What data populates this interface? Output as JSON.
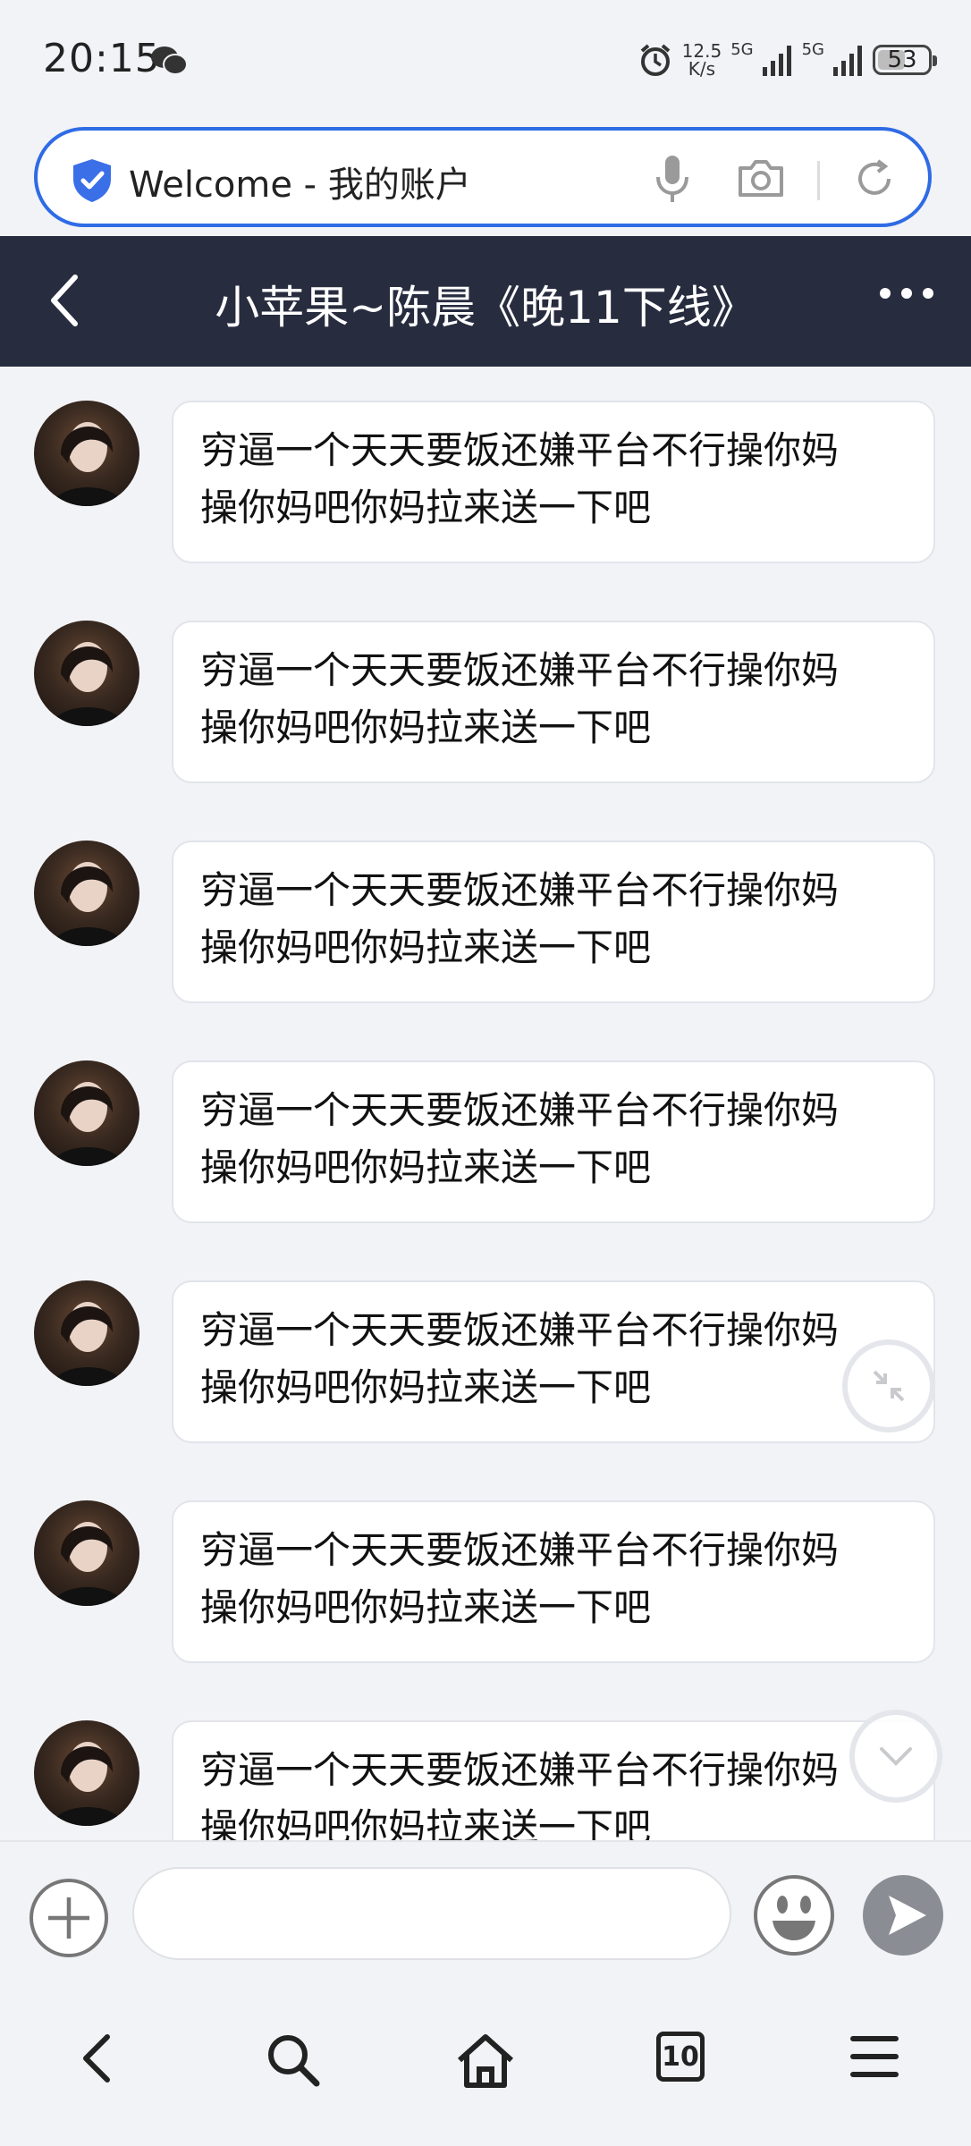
{
  "status_bar": {
    "time": "20:15",
    "net_speed_value": "12.5",
    "net_speed_unit": "K/s",
    "sim1_label": "5G",
    "sim2_label": "5G",
    "battery": "53"
  },
  "address_bar": {
    "text": "Welcome - 我的账户"
  },
  "chat": {
    "title": "小苹果~陈晨《晚11下线》",
    "messages": [
      {
        "line1": "穷逼一个天天要饭还嫌平台不行操你妈",
        "line2": "操你妈吧你妈拉来送一下吧"
      },
      {
        "line1": "穷逼一个天天要饭还嫌平台不行操你妈",
        "line2": "操你妈吧你妈拉来送一下吧"
      },
      {
        "line1": "穷逼一个天天要饭还嫌平台不行操你妈",
        "line2": "操你妈吧你妈拉来送一下吧"
      },
      {
        "line1": "穷逼一个天天要饭还嫌平台不行操你妈",
        "line2": "操你妈吧你妈拉来送一下吧"
      },
      {
        "line1": "穷逼一个天天要饭还嫌平台不行操你妈",
        "line2": "操你妈吧你妈拉来送一下吧"
      },
      {
        "line1": "穷逼一个天天要饭还嫌平台不行操你妈",
        "line2": "操你妈吧你妈拉来送一下吧"
      },
      {
        "line1": "穷逼一个天天要饭还嫌平台不行操你妈",
        "line2": "操你妈吧你妈拉来送一下吧"
      }
    ]
  },
  "input": {
    "value": ""
  },
  "bottom_nav": {
    "tab_count": "10"
  },
  "colors": {
    "accent": "#2f6be5",
    "header_bg": "#272c3f",
    "page_bg": "#f2f3f7",
    "send_button": "#8a8d93"
  },
  "icons": [
    "wechat-icon",
    "alarm-icon",
    "signal-icon",
    "shield-check-icon",
    "mic-icon",
    "camera-icon",
    "reload-icon",
    "back-icon",
    "more-icon",
    "collapse-icon",
    "chevron-down-icon",
    "plus-icon",
    "emoji-icon",
    "send-icon",
    "search-icon",
    "home-icon",
    "menu-icon"
  ]
}
